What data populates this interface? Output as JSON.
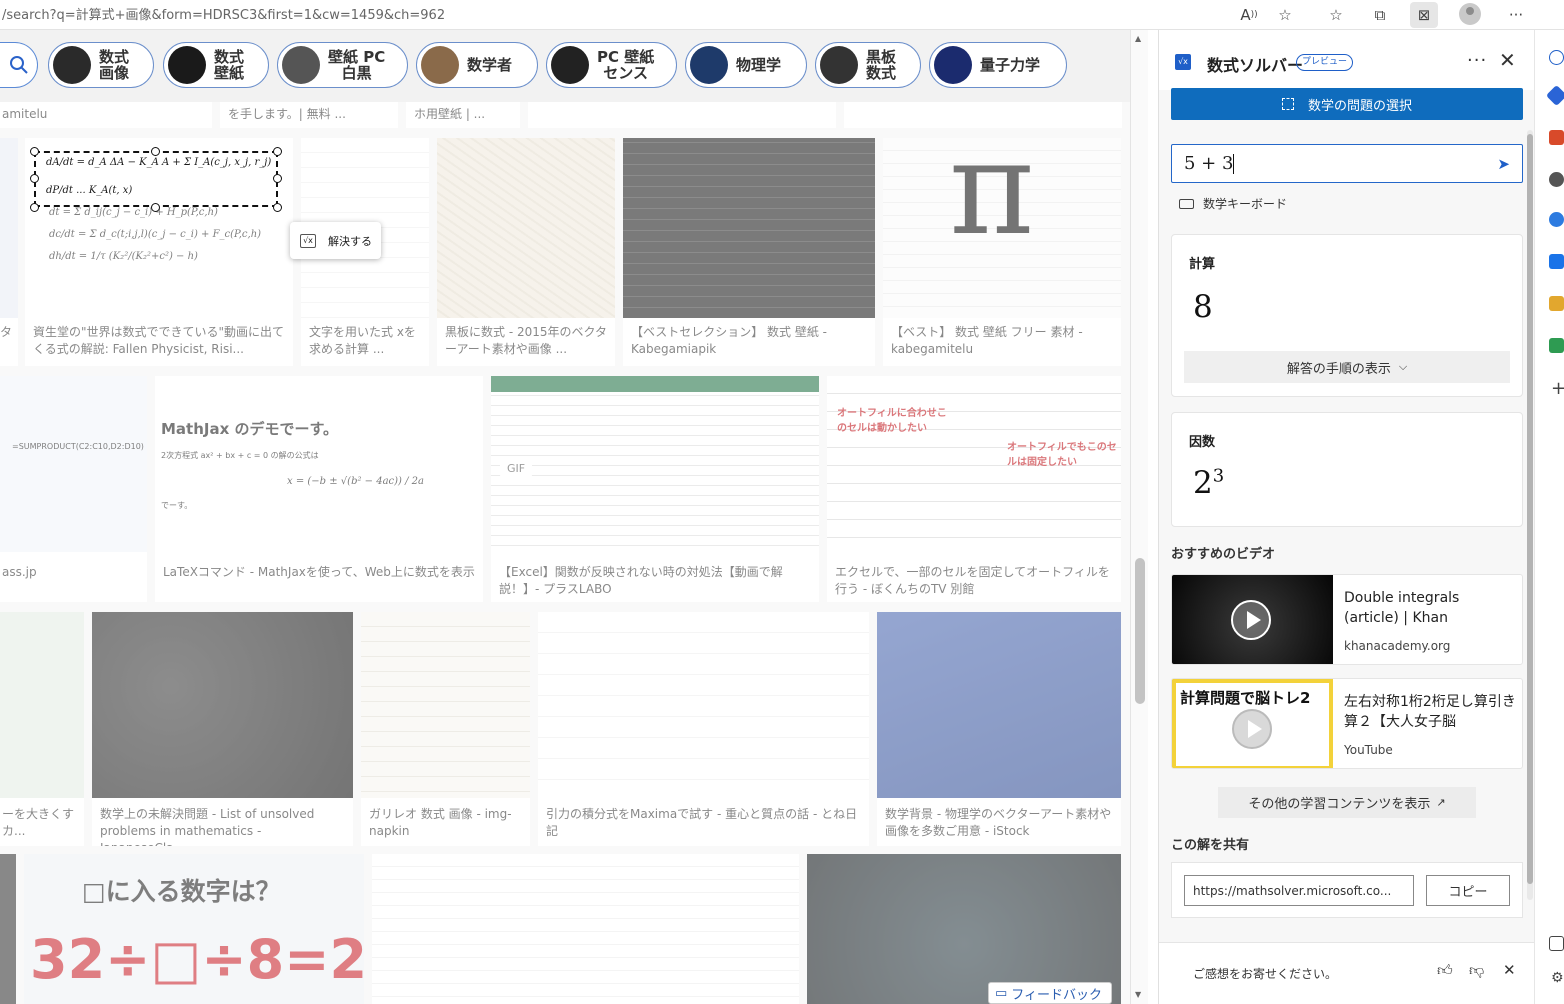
{
  "browser": {
    "url": "/search?q=計算式+画像&form=HDRSC3&first=1&cw=1459&ch=962",
    "toolbar_icons": [
      "read-aloud-icon",
      "add-favorite-icon",
      "favorites-icon",
      "collections-icon",
      "math-solver-icon",
      "profile-icon",
      "more-icon"
    ]
  },
  "chips": [
    {
      "label": "数式\n画像",
      "thumb": "#2a2a2a"
    },
    {
      "label": "数式\n壁紙",
      "thumb": "#1a1a1a"
    },
    {
      "label": "壁紙 PC\n白黒",
      "thumb": "#555555"
    },
    {
      "label": "数学者",
      "thumb": "#8a6a4a"
    },
    {
      "label": "PC 壁紙\nセンス",
      "thumb": "#222222"
    },
    {
      "label": "物理学",
      "thumb": "#1e3a6a"
    },
    {
      "label": "黒板\n数式",
      "thumb": "#333333"
    },
    {
      "label": "量子力学",
      "thumb": "#1b2b6e"
    }
  ],
  "results": {
    "row0_captions": [
      "amitelu",
      "を手します。| 無料 ...",
      "ホ用壁紙 | ..."
    ],
    "row1_captions": [
      "資生堂の\"世界は数式でできている\"動画に出てくる式の解説: Fallen Physicist, Risi...",
      "文字を用いた式 xを求める計算 ...",
      "黒板に数式 - 2015年のベクターアート素材や画像 ...",
      "【ベストセレクション】 数式 壁紙 - Kabegamiapik",
      "【ベスト】 数式 壁紙 フリー 素材 - kabegamitelu"
    ],
    "row2_captions": [
      "ass.jp",
      "LaTeXコマンド - MathJaxを使って、Web上に数式を表示",
      "【Excel】関数が反映されない時の対処法【動画で解説！】- プラスLABO",
      "エクセルで、一部のセルを固定してオートフィルを行う - ぼくんちのTV 別館"
    ],
    "row3_captions": [
      "ーを大きくすカ...",
      "数学上の未解決問題 - List of unsolved problems in mathematics - JapaneseCla...",
      "ガリレオ 数式 画像 - img-napkin",
      "引力の積分式をMaximaで試す - 重心と質点の話 - とね日記",
      "数学背景 - 物理学のベクターアート素材や画像を多数ご用意 - iStock"
    ],
    "thumb_texts": {
      "mathjax_title": "MathJax のデモでーす。",
      "mathjax_line": "2次方程式 ax² + bx + c = 0 の解の公式は",
      "mathjax_formula": "x = (−b ± √(b² − 4ac)) / 2a",
      "mathjax_end": "でーす。",
      "excel_note1": "オートフィルに合わせこのセルは動かしたい",
      "excel_note2": "オートフィルでもこのセルは固定したい",
      "quiz_title": "□に入る数字は？",
      "quiz_eq": "32÷□÷8=2",
      "sumproduct": "=SUMPRODUCT(C2:C10,D2:D10)",
      "pi": "π",
      "gif": "GIF"
    },
    "feedback": "フィードバック"
  },
  "selection": {
    "solve_button": "解決する",
    "formula_line1": "dA/dt = d_A ΔA − K_A A + Σ I_A(c_j, x_j, r_j)",
    "formula_line2": "dP/dt ... K_A(t, x)"
  },
  "solver": {
    "title": "数式ソルバー",
    "badge": "プレビュー",
    "select_button": "数学の問題の選択",
    "input_value": "5 + 3",
    "keyboard_label": "数学キーボード",
    "calc_label": "計算",
    "calc_result": "8",
    "steps_button": "解答の手順の表示",
    "factor_label": "因数",
    "factor_base": "2",
    "factor_exp": "3",
    "videos_heading": "おすすめのビデオ",
    "videos": [
      {
        "title": "Double integrals (article) | Khan",
        "source": "khanacademy.org"
      },
      {
        "title": "左右対称1桁2桁足し算引き算２【大人女子脳",
        "source": "YouTube",
        "thumb_text": "計算問題で脳トレ2"
      }
    ],
    "more_content": "その他の学習コンテンツを表示",
    "share_heading": "この解を共有",
    "share_url": "https://mathsolver.microsoft.co...",
    "copy_button": "コピー",
    "feedback": "ご感想をお寄せください。"
  }
}
